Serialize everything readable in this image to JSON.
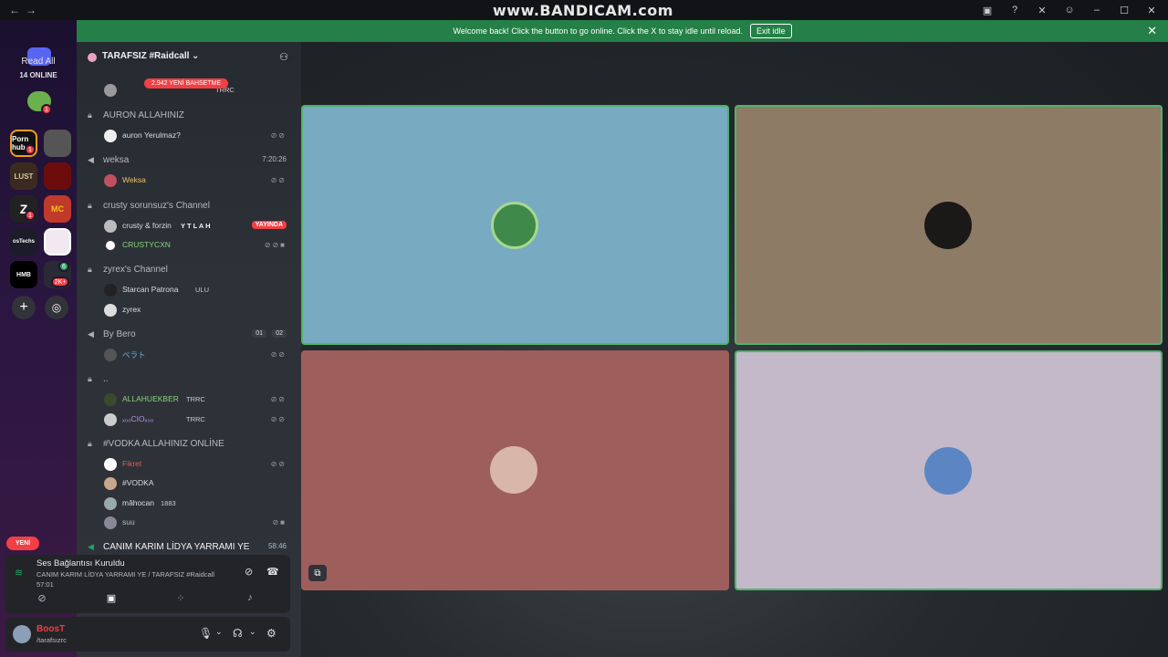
{
  "watermark": "www.BANDICAM.com",
  "titlebar": {
    "back": "←",
    "forward": "→"
  },
  "servers": {
    "read_all": "Read All",
    "online": "14 ONLINE",
    "icons": [
      {
        "name": "porn",
        "label": "Porn hub",
        "badge": "1"
      },
      {
        "name": "lust",
        "label": "LUST"
      },
      {
        "name": "z",
        "label": "Z",
        "badge": "1"
      },
      {
        "name": "mc",
        "label": "MC"
      },
      {
        "name": "ostechs",
        "label": "osTechs"
      },
      {
        "name": "hmb",
        "label": "HMB"
      },
      {
        "name": "shield",
        "label": "2K+",
        "badge": "6"
      }
    ],
    "new_label": "YENİ"
  },
  "banner": {
    "text": "Welcome back! Click the button to go online. Click the X to stay idle until reload.",
    "exit_label": "Exit idle",
    "close": "✕"
  },
  "guild": {
    "name": "TARAFSIZ #Raidcall",
    "chevron": "⌄"
  },
  "mention_pill": "2.942 YENİ BAHSETME",
  "channels": [
    {
      "label": "AURON ALLAHINIZ",
      "type": "locked",
      "users": [
        {
          "name": "auron Yerulmaz?"
        }
      ]
    },
    {
      "label": "weksa",
      "type": "voice",
      "right": "7:20:26",
      "users": [
        {
          "name": "Weksa"
        }
      ]
    },
    {
      "label": "crusty sorunsuz's Channel",
      "type": "locked",
      "users": [
        {
          "name": "crusty & forzin",
          "tag": "Y T L A H",
          "live": "YAYINDA"
        },
        {
          "name": "CRUSTYCXN"
        }
      ]
    },
    {
      "label": "zyrex's Channel",
      "type": "locked",
      "users": [
        {
          "name": "Starcan Patrona",
          "tag": "ULU"
        },
        {
          "name": "zyrex"
        }
      ]
    },
    {
      "label": "By Bero",
      "type": "voice",
      "counts": [
        "01",
        "02"
      ],
      "users": [
        {
          "name": "ベラト"
        }
      ]
    },
    {
      "label": "..",
      "type": "locked",
      "users": [
        {
          "name": "ALLAHUEKBER",
          "tag": "TRRC"
        },
        {
          "name": "ₓ₀ₒCIOₓ₀ₒ",
          "tag": "TRRC"
        }
      ]
    },
    {
      "label": "#VODKA ALLAHINIZ ONLİNE",
      "type": "locked",
      "users": [
        {
          "name": "Fikret"
        },
        {
          "name": "#VODKA"
        },
        {
          "name": "mâhocan",
          "tag": "1883"
        },
        {
          "name": "suu"
        }
      ]
    },
    {
      "label": "CANIM KARIM LİDYA YARRAMI YE",
      "type": "voice",
      "right": "58:46"
    }
  ],
  "top_partial": {
    "name": "TRRC"
  },
  "voice_panel": {
    "status": "Ses Bağlantısı Kuruldu",
    "channel": "CANIM KARIM LİDYA YARRAMI YE / TARAFSIZ #Raidcall",
    "time": "57:01"
  },
  "user": {
    "name": "BoosT",
    "status": "/tarafsızrc"
  },
  "tiles": [
    {
      "name": "tile-1",
      "bg": "#78aac2"
    },
    {
      "name": "tile-2",
      "bg": "#8d7b66"
    },
    {
      "name": "tile-3",
      "bg": "#9e5e5c"
    },
    {
      "name": "tile-4",
      "bg": "#c3b9c8"
    }
  ],
  "colors": {
    "accent_green": "#248046",
    "danger": "#f23f43",
    "active_border": "#4fb36a"
  }
}
